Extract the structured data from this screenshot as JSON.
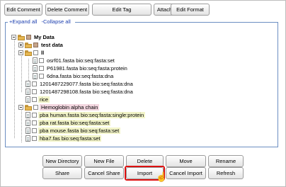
{
  "toolbar": {
    "edit_comment": "Edit Comment",
    "delete_comment": "Delete Comment",
    "edit_tag": "Edit Tag",
    "attach_tag": "Attach Tag",
    "edit_format": "Edit Format"
  },
  "tree": {
    "expand_all": "+Expand all",
    "collapse_all": "-Collapse all",
    "items": [
      {
        "label": "My Data"
      },
      {
        "label": "test data"
      },
      {
        "label": "ll"
      },
      {
        "label": "osrf01.fasta bio:seq:fasta:set"
      },
      {
        "label": "P61981.fasta bio:seq:fasta:protein"
      },
      {
        "label": "6dna.fasta bio:seq:fasta:dna"
      },
      {
        "label": "1201487229077.fasta bio:seq:fasta:dna"
      },
      {
        "label": "1201487298108.fasta bio:seq:fasta:dna"
      },
      {
        "label": "rice"
      },
      {
        "label": "Hemoglobin alpha chain"
      },
      {
        "label": "pba human.fasta bio:seq:fasta:single:protein"
      },
      {
        "label": "pba rat.fasta bio:seq:fasta:set"
      },
      {
        "label": "pba mouse.fasta bio:seq:fasta:set"
      },
      {
        "label": "hba7.fas bio:seq:fasta:set"
      }
    ]
  },
  "actions": {
    "new_directory": "New Directory",
    "new_file": "New File",
    "delete": "Delete",
    "move": "Move",
    "rename": "Rename",
    "share": "Share",
    "cancel_share": "Cancel Share",
    "import": "Import",
    "cancel_import": "Cancel Import",
    "refresh": "Refresh"
  },
  "colors": {
    "highlight": "#dd1111",
    "tag_background": "#f2f4c8",
    "selected_background": "#f3d7e0",
    "link": "#1a3dae"
  }
}
